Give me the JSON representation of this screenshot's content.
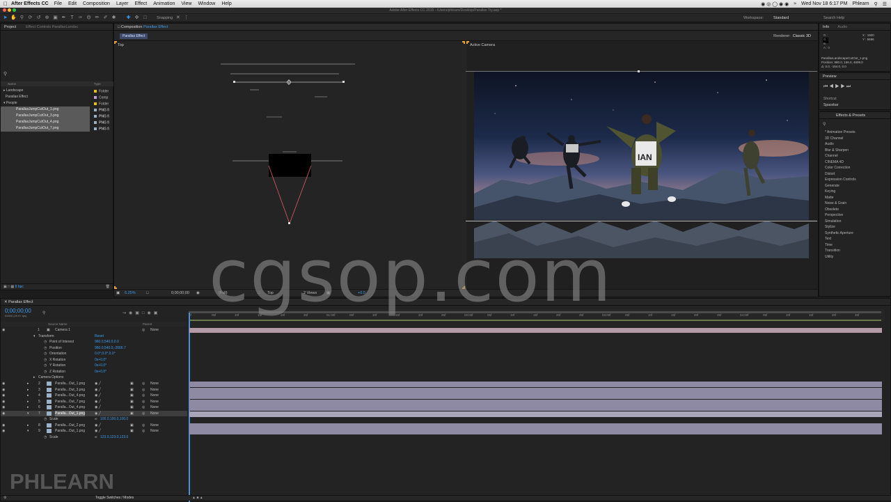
{
  "menubar": {
    "app_name": "After Effects CC",
    "items": [
      "File",
      "Edit",
      "Composition",
      "Layer",
      "Effect",
      "Animation",
      "View",
      "Window",
      "Help"
    ],
    "clock": "Wed Nov 18  6:17 PM",
    "user": "Phlearn",
    "wifi_count": "11"
  },
  "title": "Adobe After Effects CC 2015 - /Users/phlearn/Desktop/Parallax Try.aep *",
  "toolbar": {
    "snapping_label": "Snapping",
    "workspace_label": "Workspace:",
    "workspace_value": "Standard",
    "search_help": "Search Help"
  },
  "project_panel": {
    "tab_label": "Project",
    "effect_controls_tab": "Effect Controls ParallaxLandsc",
    "search_icon": "search-icon",
    "col_name": "Name",
    "col_type": "Type",
    "rows": [
      {
        "name": "Landscape",
        "type": "Folder",
        "color": "#e8c300",
        "indent": 0
      },
      {
        "name": "Parallax Effect",
        "type": "Comp",
        "color": "#c1a0d8",
        "indent": 0
      },
      {
        "name": "People",
        "type": "Folder",
        "color": "#e8c300",
        "indent": 0
      },
      {
        "name": "ParallaxJumpCutOut_1.png",
        "type": "PNG fi",
        "color": "#9ab1c6",
        "indent": 1,
        "selected": true
      },
      {
        "name": "ParallaxJumpCutOut_3.png",
        "type": "PNG fi",
        "color": "#9ab1c6",
        "indent": 1,
        "selected": true
      },
      {
        "name": "ParallaxJumpCutOut_4.png",
        "type": "PNG fi",
        "color": "#9ab1c6",
        "indent": 1,
        "selected": true
      },
      {
        "name": "ParallaxJumpCutOut_7.png",
        "type": "PNG fi",
        "color": "#9ab1c6",
        "indent": 1,
        "selected": true
      }
    ],
    "bpc": "8 bpc"
  },
  "composition_panel": {
    "tab_prefix": "Composition",
    "tab_comp_name": "Parallax Effect",
    "sub_tab": "Parallax Effect",
    "renderer_label": "Renderer:",
    "renderer_value": "Classic 3D",
    "left_view_label": "Top",
    "right_view_label": "Active Camera",
    "zoom": "6.25%",
    "timecode": "0;00;00;00",
    "resolution": "(Full)",
    "view_select": "Top",
    "views_layout": "2 Views",
    "exposure": "+0.0"
  },
  "info_panel": {
    "tab_info": "Info",
    "tab_audio": "Audio",
    "x_value": "X : 1920",
    "y_value": "Y : 5696",
    "r": "R :",
    "g": "G :",
    "b": "B :",
    "a": "A : 0",
    "layer_name": "ParallaxLandscapeCutOut_1.png",
    "position": "Position: 880.0, 166.0, 4608.0",
    "delta": "Δ: 0.0, -154.0, 0.0"
  },
  "preview_panel": {
    "tab": "Preview",
    "shortcut_label": "Shortcut",
    "shortcut_value": "Spacebar"
  },
  "effects_panel": {
    "tab": "Effects & Presets",
    "items": [
      "* Animation Presets",
      "3D Channel",
      "Audio",
      "Blur & Sharpen",
      "Channel",
      "CINEMA 4D",
      "Color Correction",
      "Distort",
      "Expression Controls",
      "Generate",
      "Keying",
      "Matte",
      "Noise & Grain",
      "Obsolete",
      "Perspective",
      "Simulation",
      "Stylize",
      "Synthetic Aperture",
      "Text",
      "Time",
      "Transition",
      "Utility"
    ]
  },
  "timeline": {
    "tab_label": "Parallax Effect",
    "timecode": "0;00;00;00",
    "fps": "00000 (29.97 fps)",
    "col_source": "Source Name",
    "col_parent": "Parent",
    "ruler_labels": [
      "0f",
      "05f",
      "10f",
      "15f",
      "20f",
      "25f",
      "01:00f",
      "05f",
      "10f",
      "15f",
      "20f",
      "25f",
      "02:00f",
      "05f",
      "10f",
      "15f",
      "20f",
      "25f",
      "03:00f",
      "05f",
      "10f",
      "15f",
      "20f",
      "25f",
      "04:00f",
      "05f",
      "10f",
      "15f",
      "20f",
      "25f"
    ],
    "camera": {
      "num": "1",
      "name": "Camera 1",
      "parent": "None"
    },
    "transform_label": "Transform",
    "reset_label": "Reset",
    "properties": [
      {
        "name": "Point of Interest",
        "value": "960.0,540.0,0.0"
      },
      {
        "name": "Position",
        "value": "960.0,540.0,-2666.7"
      },
      {
        "name": "Orientation",
        "value": "0.0°,0.0°,0.0°"
      },
      {
        "name": "X Rotation",
        "value": "0x+0.0°"
      },
      {
        "name": "Y Rotation",
        "value": "0x+0.0°"
      },
      {
        "name": "Z Rotation",
        "value": "0x+0.0°"
      }
    ],
    "camera_options_label": "Camera Options",
    "layers_a": [
      {
        "num": "2",
        "name": "Paralla...Out_1.png",
        "parent": "None"
      },
      {
        "num": "3",
        "name": "Paralla...Out_3.png",
        "parent": "None"
      },
      {
        "num": "4",
        "name": "Paralla...Out_4.png",
        "parent": "None"
      },
      {
        "num": "5",
        "name": "Paralla...Out_7.png",
        "parent": "None"
      },
      {
        "num": "6",
        "name": "Paralla...Out_4.png",
        "parent": "None"
      },
      {
        "num": "7",
        "name": "Paralla...Out_1.png",
        "parent": "None"
      }
    ],
    "scale_label": "Scale",
    "scale_a": "100.0,100.0,100.0",
    "layers_b": [
      {
        "num": "8",
        "name": "Paralla...Out_2.png",
        "parent": "None"
      },
      {
        "num": "9",
        "name": "Paralla...Out_1.png",
        "parent": "None"
      }
    ],
    "scale_b": "123.0,123.0,123.0",
    "toggle_label": "Toggle Switches / Modes"
  },
  "watermarks": {
    "center": "cgsop.com",
    "corner": "PHLEARN"
  }
}
